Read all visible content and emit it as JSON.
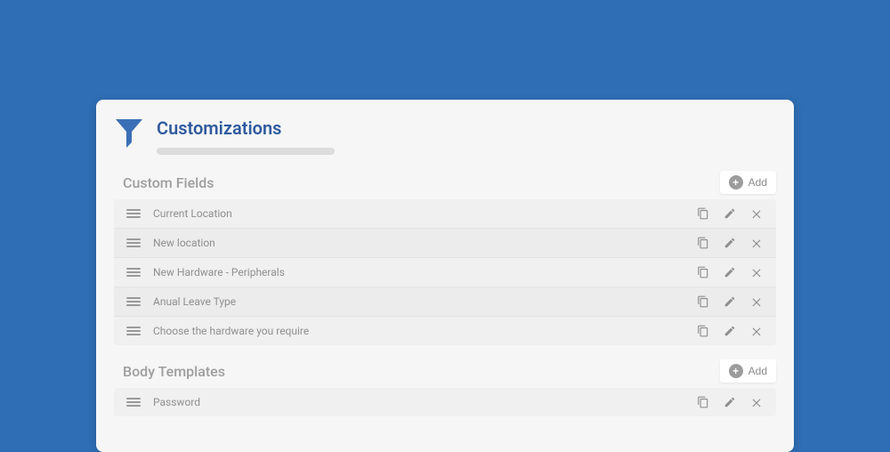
{
  "page": {
    "title": "Customizations"
  },
  "sections": [
    {
      "title": "Custom Fields",
      "add_label": "Add",
      "items": [
        {
          "label": "Current Location"
        },
        {
          "label": "New location"
        },
        {
          "label": "New Hardware - Peripherals"
        },
        {
          "label": "Anual Leave Type"
        },
        {
          "label": "Choose the hardware you require"
        }
      ]
    },
    {
      "title": "Body Templates",
      "add_label": "Add",
      "items": [
        {
          "label": "Password"
        }
      ]
    }
  ]
}
